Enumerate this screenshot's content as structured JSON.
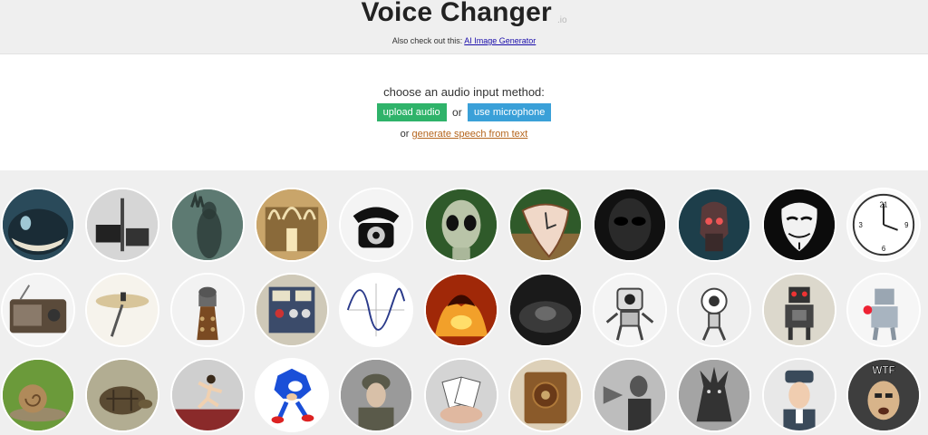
{
  "header": {
    "title": "Voice Changer",
    "tld": ".io",
    "also_text": "Also check out this: ",
    "also_link": "AI Image Generator"
  },
  "input": {
    "prompt": "choose an audio input method:",
    "upload_label": "upload audio",
    "or_label": "or",
    "mic_label": "use microphone",
    "tts_prefix": "or ",
    "tts_link": "generate speech from text"
  },
  "colors": {
    "upload_button": "#2fb36a",
    "mic_button": "#3aa0d8",
    "tts_link": "#b5651d",
    "also_link": "#1a0dab"
  },
  "voices": [
    [
      {
        "name": "monster-icon",
        "theme": "#2a4a5a"
      },
      {
        "name": "megaphone-icon",
        "theme": "#cfcfcf"
      },
      {
        "name": "ghost-icon",
        "theme": "#6f8a82"
      },
      {
        "name": "cathedral-icon",
        "theme": "#b8955a"
      },
      {
        "name": "telephone-icon",
        "theme": "#f2f2f2"
      },
      {
        "name": "alien-icon",
        "theme": "#3b6b34"
      },
      {
        "name": "melting-clock-icon",
        "theme": "#2f5a2a"
      },
      {
        "name": "dark-alien-icon",
        "theme": "#1d1d1d"
      },
      {
        "name": "cyborg-icon",
        "theme": "#2e5a6a"
      },
      {
        "name": "anonymous-mask-icon",
        "theme": "#111111"
      },
      {
        "name": "reversed-clock-icon",
        "theme": "#f7f7f7"
      }
    ],
    [
      {
        "name": "radio-icon",
        "theme": "#f2f2f2"
      },
      {
        "name": "gramophone-icon",
        "theme": "#f4f1ea"
      },
      {
        "name": "dalek-icon",
        "theme": "#f2f2f2"
      },
      {
        "name": "synthesizer-icon",
        "theme": "#d7d2c4"
      },
      {
        "name": "sine-wave-icon",
        "theme": "#ffffff"
      },
      {
        "name": "fire-demon-icon",
        "theme": "#7a1e0a"
      },
      {
        "name": "cave-icon",
        "theme": "#2a2a2a"
      },
      {
        "name": "robot-white-icon",
        "theme": "#f4f4f4"
      },
      {
        "name": "robot-eye-icon",
        "theme": "#f0f0f0"
      },
      {
        "name": "toy-robot-icon",
        "theme": "#dcd8cc"
      },
      {
        "name": "tin-robot-icon",
        "theme": "#f6f6f6"
      }
    ],
    [
      {
        "name": "snail-icon",
        "theme": "#6b8f3a"
      },
      {
        "name": "tortoise-icon",
        "theme": "#a9a48a"
      },
      {
        "name": "sprinter-icon",
        "theme": "#c9c9c9"
      },
      {
        "name": "sonic-icon",
        "theme": "#ffffff"
      },
      {
        "name": "soldier-icon",
        "theme": "#8a8a8a"
      },
      {
        "name": "cards-icon",
        "theme": "#cfcfcf"
      },
      {
        "name": "wooden-radio-icon",
        "theme": "#d8c9b0"
      },
      {
        "name": "old-gramophone-man-icon",
        "theme": "#bdbdbd"
      },
      {
        "name": "dark-creature-icon",
        "theme": "#9a9a9a"
      },
      {
        "name": "russian-man-icon",
        "theme": "#e6e6e6"
      },
      {
        "name": "wtf-meme-icon",
        "theme": "#4a4a4a"
      }
    ]
  ],
  "wtf_text": "WTF"
}
